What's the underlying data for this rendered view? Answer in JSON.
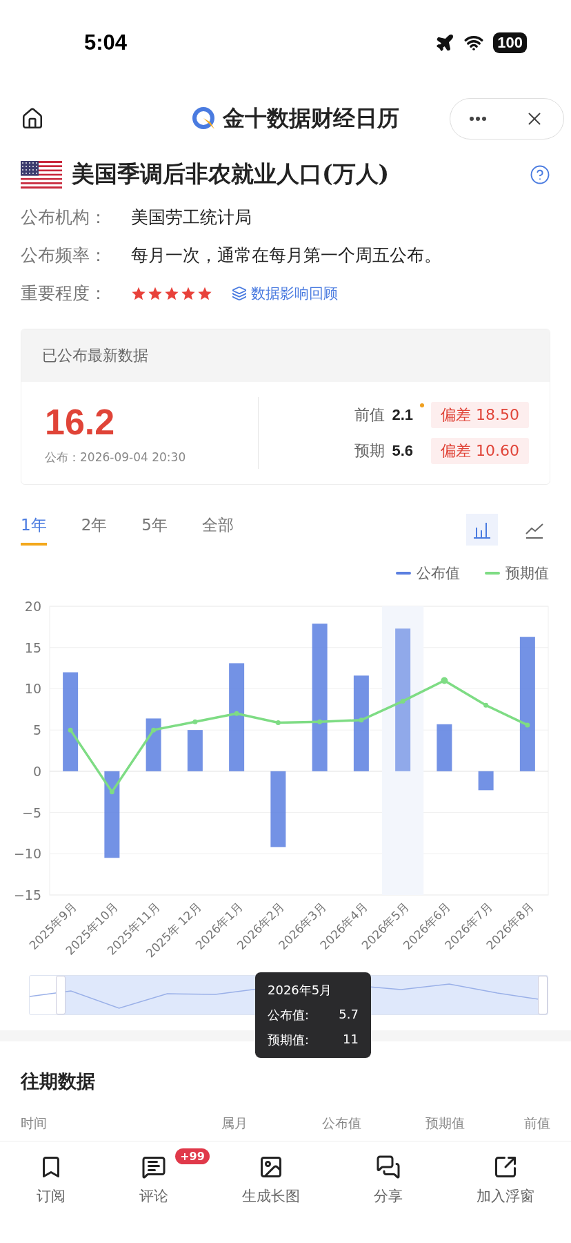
{
  "status_bar": {
    "time": "5:04",
    "battery": "100"
  },
  "header": {
    "title": "金十数据财经日历"
  },
  "indicator": {
    "title": "美国季调后非农就业人口(万人)",
    "stars": 5,
    "info": [
      {
        "label": "公布机构：",
        "value": "美国劳工统计局"
      },
      {
        "label": "公布频率：",
        "value": "每月一次，通常在每月第一个周五公布。"
      }
    ],
    "importance_label": "重要程度：",
    "review_link": "数据影响回顾"
  },
  "latest": {
    "heading": "已公布最新数据",
    "actual": "16.2",
    "published": "公布：2026-09-04 20:30",
    "rows": [
      {
        "label": "前值",
        "value": "2.1",
        "revised": true,
        "deviation": "偏差 18.50"
      },
      {
        "label": "预期",
        "value": "5.6",
        "revised": false,
        "deviation": "偏差 10.60"
      }
    ]
  },
  "range_tabs": [
    {
      "label": "1年",
      "selected": true
    },
    {
      "label": "2年",
      "selected": false
    },
    {
      "label": "5年",
      "selected": false
    },
    {
      "label": "全部",
      "selected": false
    }
  ],
  "chart_types": [
    {
      "kind": "bar",
      "selected": true
    },
    {
      "kind": "line",
      "selected": false
    }
  ],
  "chart": {
    "range_slider": {
      "level": 0.94
    },
    "chart_data": {
      "type": "bar",
      "grid": true,
      "categories": [
        "2025年9月",
        "2025年10月",
        "2025年11月",
        "2025年 12月",
        "2026年1月",
        "2026年2月",
        "2026年3月",
        "2026年4月",
        "2026年5月",
        "2026年6月",
        "2026年7月",
        "2026年8月"
      ],
      "series": [
        {
          "name": "公布值",
          "type": "bar",
          "color": "#5b7fe0",
          "values": [
            12,
            -10.5,
            6.4,
            5,
            13.1,
            -9.2,
            17.9,
            11.6,
            17.3,
            5.7,
            -2.3,
            16.3
          ]
        },
        {
          "name": "预期值",
          "type": "line",
          "marker": true,
          "color": "#7edc84",
          "values": [
            5,
            -2.5,
            5,
            6,
            7,
            5.9,
            6,
            6.2,
            8.5,
            11,
            8,
            5.6
          ]
        }
      ],
      "ylim": [
        -15,
        20
      ],
      "yticks": [
        -15,
        -10,
        -5,
        0,
        5,
        10,
        15,
        20
      ]
    },
    "tooltip": {
      "title": "2026年5月",
      "rows": [
        {
          "label": "公布值:",
          "value": "5.7"
        },
        {
          "label": "预期值:",
          "value": "11"
        }
      ]
    }
  },
  "history": {
    "title": "往期数据",
    "columns": [
      "时间",
      "属月",
      "公布值",
      "预期值",
      "前值"
    ]
  },
  "bottom_nav": [
    {
      "kind": "bookmark",
      "label": "订阅"
    },
    {
      "kind": "comment",
      "label": "评论",
      "badge": "+99"
    },
    {
      "kind": "image",
      "label": "生成长图"
    },
    {
      "kind": "share",
      "label": "分享"
    },
    {
      "kind": "float",
      "label": "加入浮窗"
    }
  ]
}
